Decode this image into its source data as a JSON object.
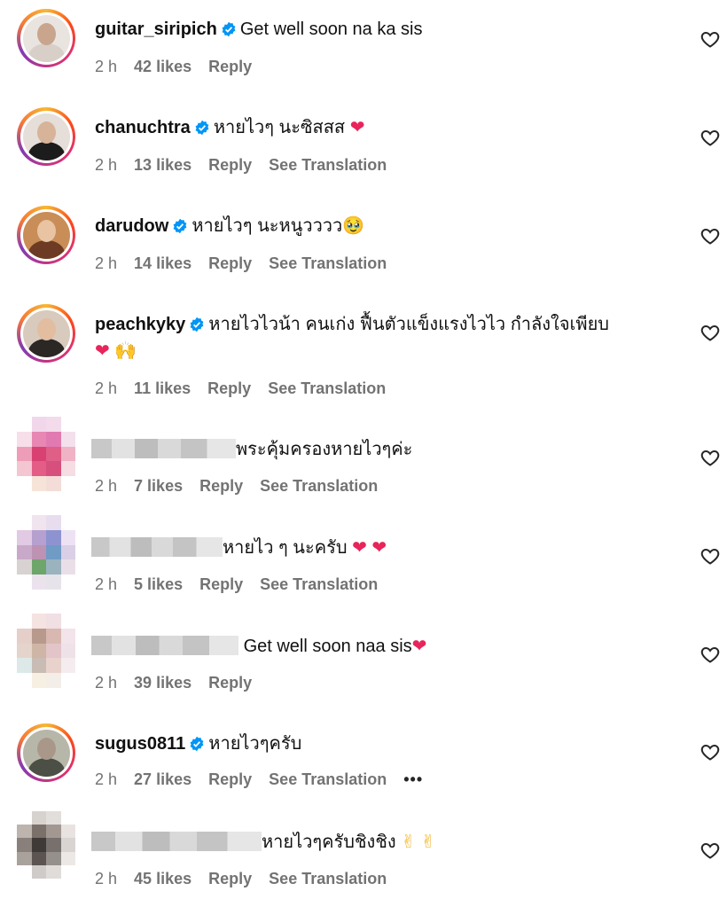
{
  "comments": [
    {
      "username": "guitar_siripich",
      "text": "Get well soon na ka sis",
      "time": "2 h",
      "likes": "42 likes",
      "reply": "Reply",
      "translate": "",
      "emoji": ""
    },
    {
      "username": "chanuchtra",
      "text": "หายไวๆ นะซิสสส",
      "time": "2 h",
      "likes": "13 likes",
      "reply": "Reply",
      "translate": "See Translation",
      "emoji": "❤"
    },
    {
      "username": "darudow",
      "text": "หายไวๆ นะหนูวววว",
      "time": "2 h",
      "likes": "14 likes",
      "reply": "Reply",
      "translate": "See Translation",
      "emoji": "🥹"
    },
    {
      "username": "peachkyky",
      "text": "หายไวไวน้า คนเก่ง ฟื้นตัวแข็งแรงไวไว กำลังใจเพียบ",
      "text2": "🙌",
      "time": "2 h",
      "likes": "11 likes",
      "reply": "Reply",
      "translate": "See Translation",
      "emoji": "❤"
    },
    {
      "username": "",
      "text": "พระคุ้มครองหายไวๆค่ะ",
      "time": "2 h",
      "likes": "7 likes",
      "reply": "Reply",
      "translate": "See Translation",
      "emoji": ""
    },
    {
      "username": "",
      "text": "หายไว ๆ นะครับ",
      "time": "2 h",
      "likes": "5 likes",
      "reply": "Reply",
      "translate": "See Translation",
      "emoji": "❤ ❤"
    },
    {
      "username": "",
      "text": "Get well soon naa sis",
      "time": "2 h",
      "likes": "39 likes",
      "reply": "Reply",
      "translate": "",
      "emoji": "❤"
    },
    {
      "username": "sugus0811",
      "text": "หายไวๆครับ",
      "time": "2 h",
      "likes": "27 likes",
      "reply": "Reply",
      "translate": "See Translation",
      "more": "•••",
      "emoji": ""
    },
    {
      "username": "",
      "text": "หายไวๆครับชิงชิง",
      "time": "2 h",
      "likes": "45 likes",
      "reply": "Reply",
      "translate": "See Translation",
      "emoji": "✌ ✌"
    }
  ],
  "colors": {
    "verified": "#0095f6",
    "meta": "#737373",
    "heart_emoji": "#e8245b"
  },
  "icons": {
    "verified": "verified-badge-icon",
    "like": "heart-outline-icon",
    "more": "more-options-icon"
  }
}
